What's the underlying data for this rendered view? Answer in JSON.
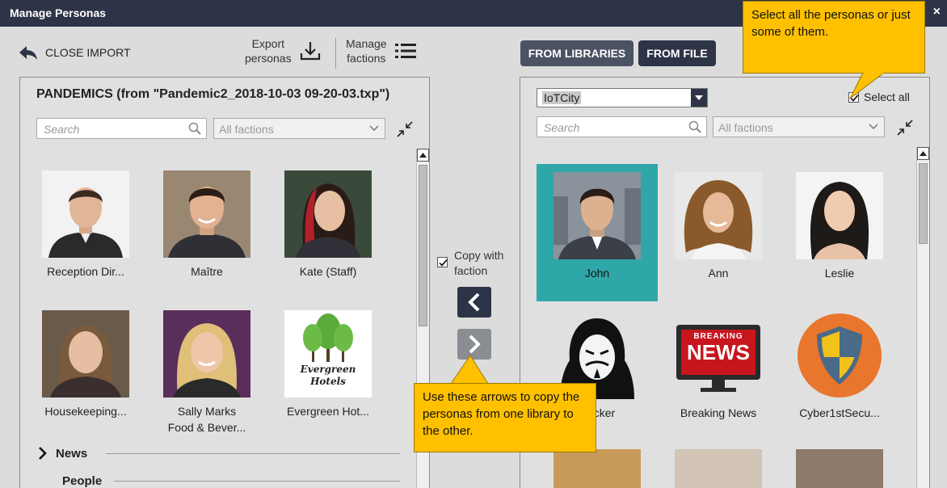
{
  "window": {
    "title": "Manage Personas",
    "close_glyph": "×"
  },
  "toolbar": {
    "close_import": "CLOSE IMPORT",
    "export": {
      "line1": "Export",
      "line2": "personas"
    },
    "manage": {
      "line1": "Manage",
      "line2": "factions"
    }
  },
  "source_tabs": {
    "from_libraries": "FROM LIBRARIES",
    "from_file": "FROM FILE"
  },
  "left_library": {
    "title": "PANDEMICS (from \"Pandemic2_2018-10-03 09-20-03.txp\")",
    "search_placeholder": "Search",
    "faction_filter": "All factions",
    "personas": [
      {
        "name": "Reception Dir...",
        "name2": "",
        "avatar": "man-portrait"
      },
      {
        "name": "Maître",
        "name2": "",
        "avatar": "man-smiling-portrait"
      },
      {
        "name": "Kate (Staff)",
        "name2": "",
        "avatar": "woman-red-hair-portrait"
      },
      {
        "name": "Housekeeping...",
        "name2": "",
        "avatar": "woman-portrait"
      },
      {
        "name": "Sally Marks",
        "name2": "Food & Bever...",
        "avatar": "woman-blonde-portrait"
      },
      {
        "name": "Evergreen Hot...",
        "name2": "",
        "avatar": "tree-logo",
        "logo_text1": "Evergreen",
        "logo_text2": "Hotels"
      }
    ],
    "groups": [
      {
        "label": "News",
        "expanded": false
      },
      {
        "label": "People",
        "expanded": true
      }
    ]
  },
  "transfer": {
    "copy_with_faction": {
      "line1": "Copy with",
      "line2": "faction",
      "checked": true
    },
    "copy_left_icon": "chevron-left-icon",
    "copy_right_icon": "chevron-right-icon"
  },
  "right_library": {
    "selected_library": "IoTCity",
    "select_all_label": "Select all",
    "select_all_checked": true,
    "search_placeholder": "Search",
    "faction_filter": "All factions",
    "personas": [
      {
        "name": "John",
        "selected": true,
        "avatar": "man-suit-portrait"
      },
      {
        "name": "Ann",
        "selected": false,
        "avatar": "woman-curly-hair-portrait"
      },
      {
        "name": "Leslie",
        "selected": false,
        "avatar": "woman-dark-hair-portrait"
      },
      {
        "name": "Hacker",
        "selected": false,
        "avatar": "hacker-mask-icon"
      },
      {
        "name": "Breaking News",
        "selected": false,
        "avatar": "breaking-news-icon",
        "logo_text1": "BREAKING",
        "logo_text2": "NEWS"
      },
      {
        "name": "Cyber1stSecu...",
        "selected": false,
        "avatar": "shield-icon"
      }
    ]
  },
  "callouts": {
    "top": "Select all the personas or just some of them.",
    "bottom": "Use these arrows to copy the personas from one library to the other."
  },
  "colors": {
    "titlebar": "#2e3447",
    "selected_card": "#2fa7a8",
    "callout": "#ffc000"
  }
}
